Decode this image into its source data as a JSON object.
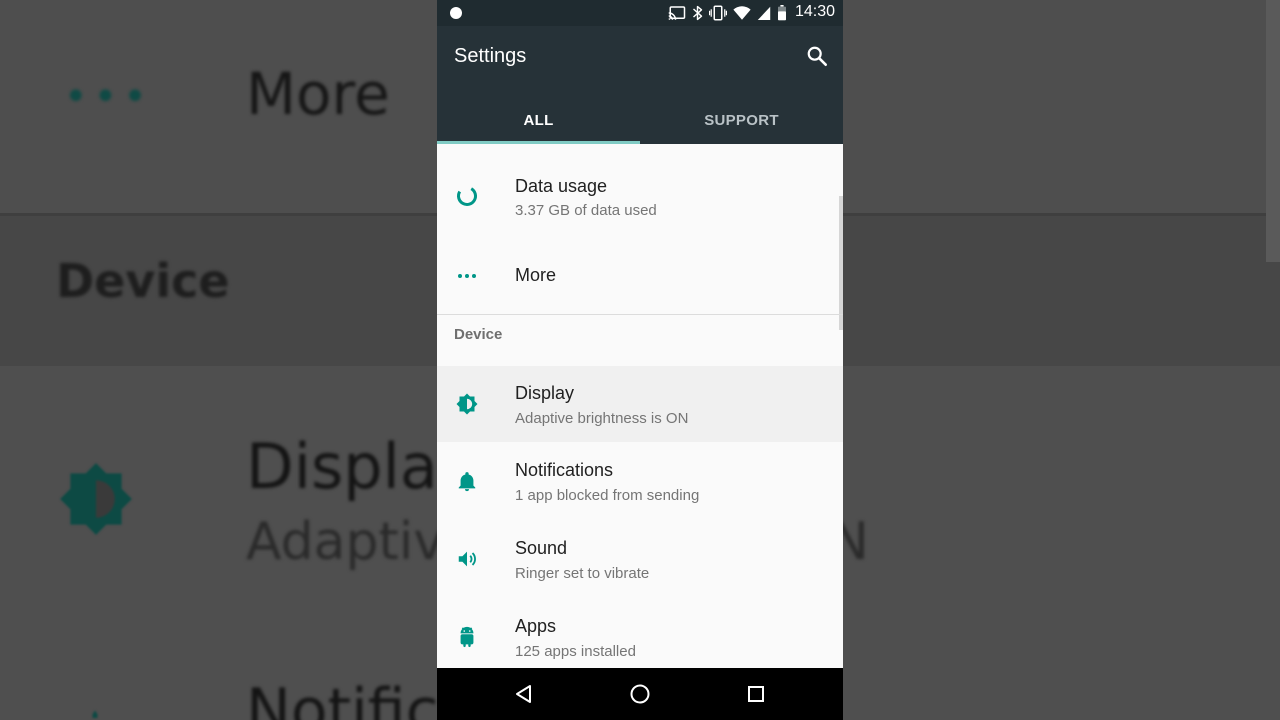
{
  "status_bar": {
    "time": "14:30",
    "icons": [
      "notification-dot-icon",
      "cast-icon",
      "bluetooth-icon",
      "vibrate-icon",
      "wifi-icon",
      "signal-icon",
      "battery-icon"
    ]
  },
  "app_bar": {
    "title": "Settings",
    "search_icon": "search-icon",
    "tabs": [
      {
        "label": "ALL",
        "active": true
      },
      {
        "label": "SUPPORT",
        "active": false
      }
    ]
  },
  "settings": {
    "items": [
      {
        "title": "Data usage",
        "subtitle": "3.37 GB of data used",
        "icon": "data-usage-icon"
      },
      {
        "title": "More",
        "subtitle": "",
        "icon": "more-dots-icon"
      },
      {
        "title": "Display",
        "subtitle": "Adaptive brightness is ON",
        "icon": "brightness-icon"
      },
      {
        "title": "Notifications",
        "subtitle": "1 app blocked from sending",
        "icon": "bell-icon"
      },
      {
        "title": "Sound",
        "subtitle": "Ringer set to vibrate",
        "icon": "volume-icon"
      },
      {
        "title": "Apps",
        "subtitle": "125 apps installed",
        "icon": "android-icon"
      }
    ],
    "section_header": "Device"
  },
  "background": {
    "more": "More",
    "device": "Device",
    "display": "Display",
    "adaptive": "Adaptive",
    "on": "N",
    "notifications": "Notifica",
    "dots": "•••"
  },
  "nav_bar": {
    "icons": [
      "back-icon",
      "home-icon",
      "recents-icon"
    ]
  },
  "colors": {
    "accent": "#009688",
    "app_bar": "#263238",
    "status_bar": "#1f2b30",
    "tab_indicator": "#80cbc4"
  }
}
